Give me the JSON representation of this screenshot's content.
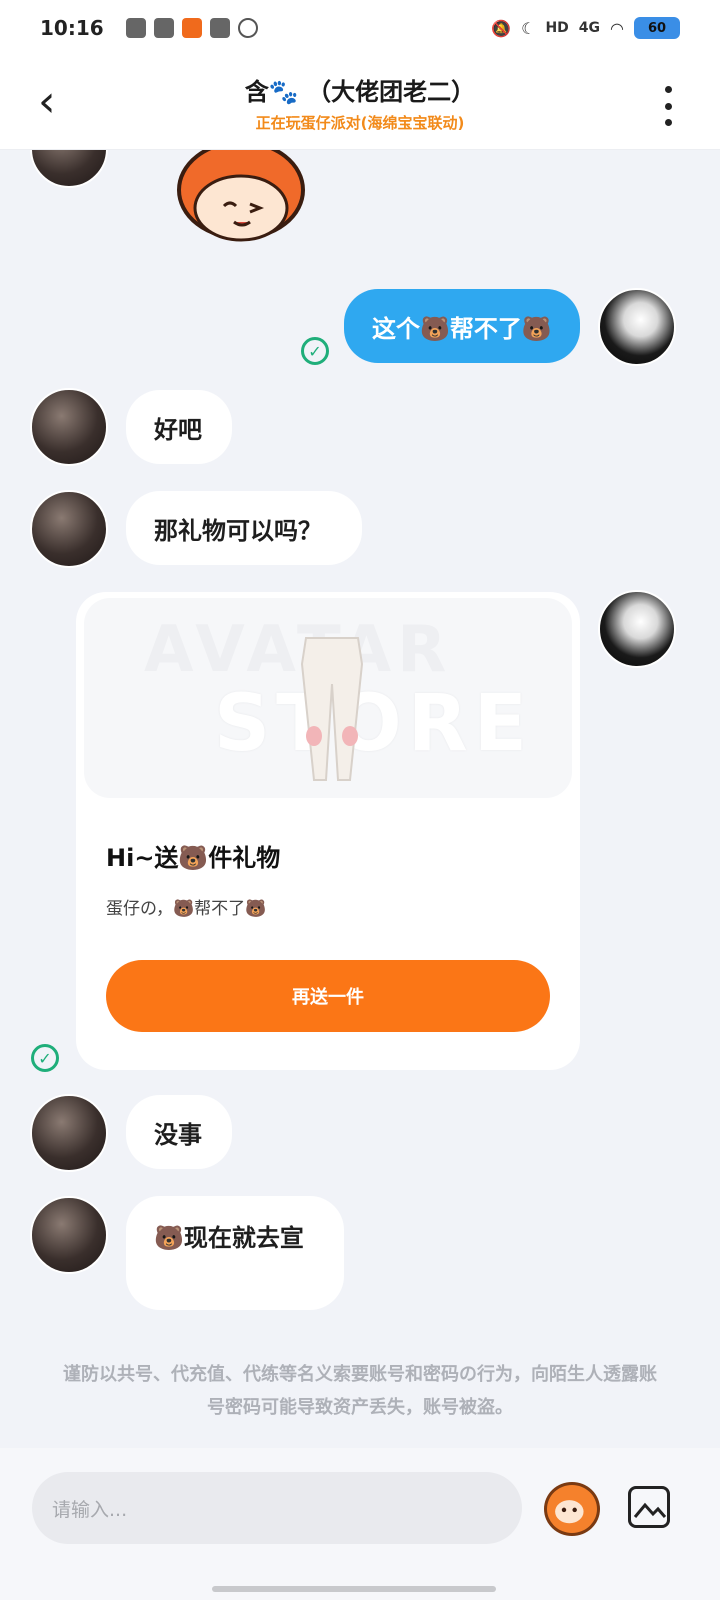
{
  "status_bar": {
    "time": "10:16",
    "network": "4G",
    "hd": "HD",
    "battery": "60"
  },
  "header": {
    "back_icon": "chevron-left-icon",
    "title": "含🐾 （大佬团老二）",
    "subtitle": "正在玩蛋仔派对(海绵宝宝联动)",
    "more_icon": "more-vertical-icon"
  },
  "messages": [
    {
      "side": "mine",
      "text": "这个🐻帮不了🐻",
      "read": true
    },
    {
      "side": "theirs",
      "text": "好吧"
    },
    {
      "side": "theirs",
      "text": "那礼物可以吗？"
    },
    {
      "side": "theirs",
      "text": "没事"
    },
    {
      "side": "theirs",
      "text": "🐻现在就去宣"
    }
  ],
  "gift_card": {
    "watermark_1": "AVATAR",
    "watermark_2": "STORE",
    "title": "Hi~送🐻件礼物",
    "description": "蛋仔の，🐻帮不了🐻",
    "button_label": "再送一件"
  },
  "disclaimer": "谨防以共号、代充值、代练等名义索要账号和密码の行为，向陌生人透露账号密码可能导致资产丢失，账号被盗。",
  "input": {
    "placeholder": "请输入..."
  },
  "colors": {
    "accent_orange": "#fb7616",
    "mine_bubble": "#2fa8f0",
    "read_check": "#1fae7a",
    "subtitle": "#f28a1a"
  }
}
